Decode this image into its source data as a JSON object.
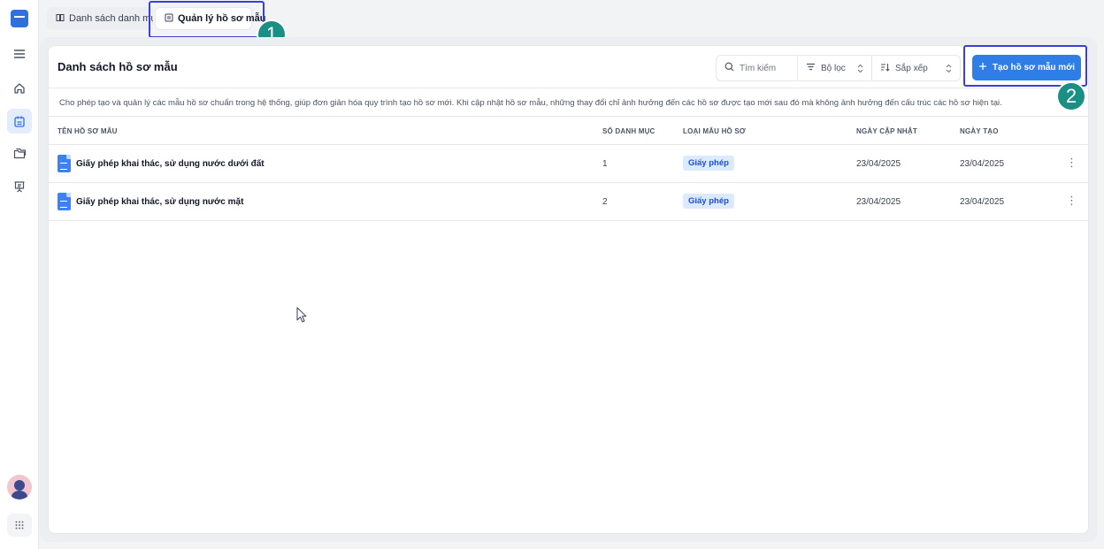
{
  "rail": {
    "logo_icon": "app-logo",
    "items": [
      {
        "icon": "menu-icon"
      },
      {
        "icon": "home-icon"
      },
      {
        "icon": "calendar-icon",
        "active": true
      },
      {
        "icon": "folders-icon"
      },
      {
        "icon": "presentation-icon"
      }
    ],
    "bottom": [
      "avatar",
      "apps-grid-icon"
    ]
  },
  "tabs": [
    {
      "label": "Danh sách danh mục",
      "icon": "catalog-icon"
    },
    {
      "label": "Quản lý hồ sơ mẫu",
      "icon": "template-icon",
      "active": true
    }
  ],
  "annotations": {
    "badge1": "1",
    "badge2": "2"
  },
  "card": {
    "title": "Danh sách hồ sơ mẫu",
    "search_placeholder": "Tìm kiếm",
    "filter_label": "Bộ lọc",
    "sort_label": "Sắp xếp",
    "create_button": "Tạo hồ sơ mẫu mới",
    "description": "Cho phép tạo và quản lý các mẫu hồ sơ chuẩn trong hệ thống, giúp đơn giản hóa quy trình tạo hồ sơ mới. Khi cập nhật hồ sơ mẫu, những thay đổi chỉ ảnh hưởng đến các hồ sơ được tạo mới sau đó mà không ảnh hưởng đến cấu trúc các hồ sơ hiện tại."
  },
  "table": {
    "columns": [
      "TÊN HỒ SƠ MẪU",
      "SỐ DANH MỤC",
      "LOẠI MẪU HỒ SƠ",
      "NGÀY CẬP NHẬT",
      "NGÀY TẠO"
    ],
    "rows": [
      {
        "name": "Giấy phép khai thác, sử dụng nước dưới đất",
        "count": "1",
        "type": "Giấy phép",
        "updated": "23/04/2025",
        "created": "23/04/2025"
      },
      {
        "name": "Giấy phép khai thác, sử dụng nước mặt",
        "count": "2",
        "type": "Giấy phép",
        "updated": "23/04/2025",
        "created": "23/04/2025"
      }
    ]
  },
  "colors": {
    "accent": "#2f7de6",
    "highlight": "#3b3fd8",
    "badge": "#1c8f85",
    "tag_bg": "#dbeafe"
  }
}
